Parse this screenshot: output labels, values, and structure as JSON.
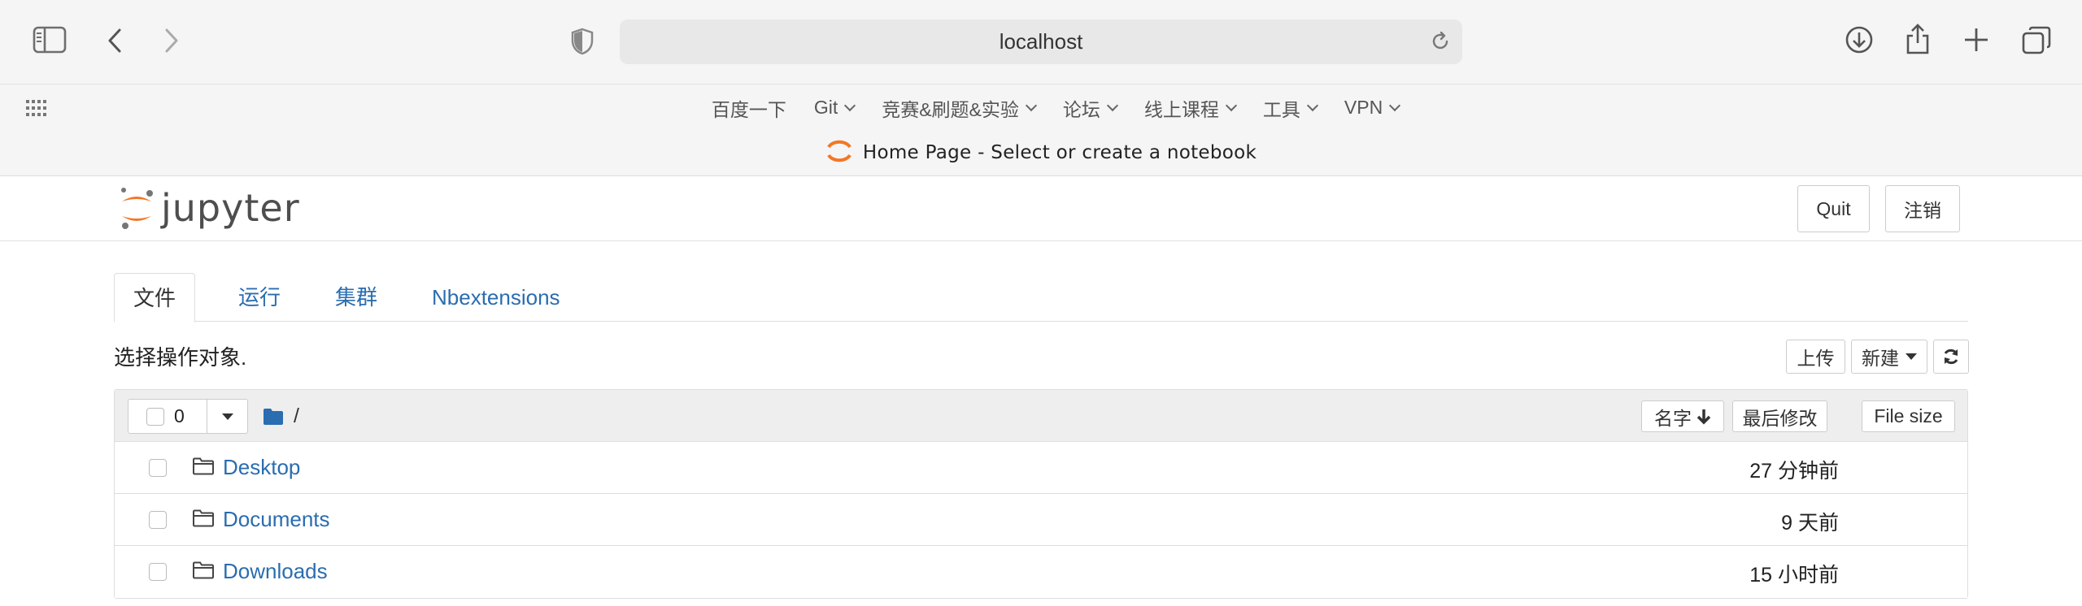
{
  "browser": {
    "url": "localhost",
    "bookmarks": [
      {
        "label": "百度一下",
        "dropdown": false
      },
      {
        "label": "Git",
        "dropdown": true
      },
      {
        "label": "竞赛&刷题&实验",
        "dropdown": true
      },
      {
        "label": "论坛",
        "dropdown": true
      },
      {
        "label": "线上课程",
        "dropdown": true
      },
      {
        "label": "工具",
        "dropdown": true
      },
      {
        "label": "VPN",
        "dropdown": true
      }
    ],
    "tab_title": "Home Page - Select or create a notebook"
  },
  "header": {
    "logo_text": "jupyter",
    "quit_label": "Quit",
    "logout_label": "注销"
  },
  "tabs": [
    {
      "label": "文件",
      "active": true
    },
    {
      "label": "运行",
      "active": false
    },
    {
      "label": "集群",
      "active": false
    },
    {
      "label": "Nbextensions",
      "active": false
    }
  ],
  "actions": {
    "hint": "选择操作对象.",
    "upload_label": "上传",
    "new_label": "新建"
  },
  "list_header": {
    "selected_count": "0",
    "path": "/",
    "name_col": "名字",
    "modified_col": "最后修改",
    "size_col": "File size"
  },
  "files": [
    {
      "name": "Desktop",
      "modified": "27 分钟前"
    },
    {
      "name": "Documents",
      "modified": "9 天前"
    },
    {
      "name": "Downloads",
      "modified": "15 小时前"
    }
  ],
  "colors": {
    "link": "#2a6db0",
    "jupyter_orange": "#f37726",
    "chrome_bg": "#f5f5f5"
  }
}
